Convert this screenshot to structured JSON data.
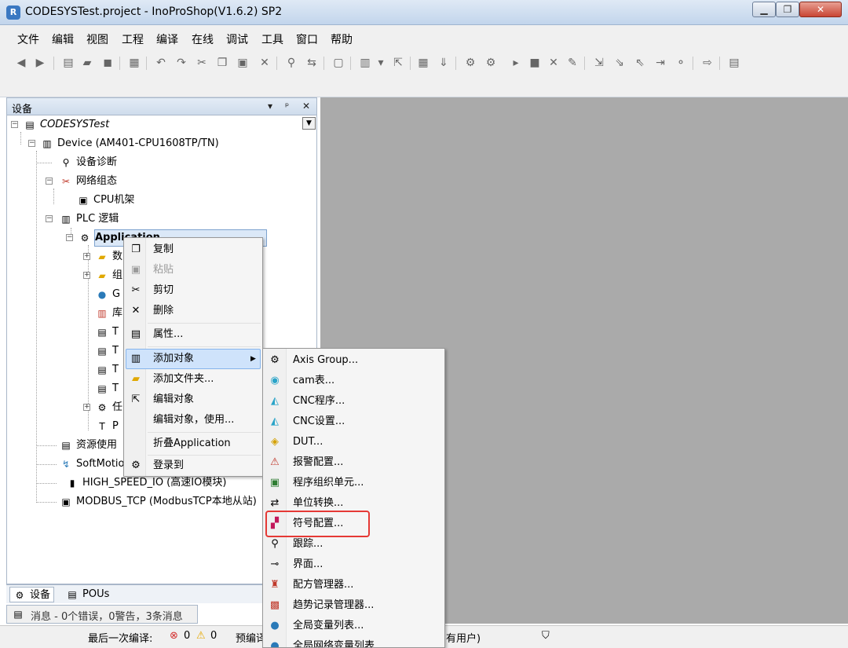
{
  "window": {
    "title": "CODESYSTest.project - InoProShop(V1.6.2) SP2",
    "icon_letter": "R",
    "min_glyph": "▁",
    "max_glyph": "❐",
    "close_glyph": "✕"
  },
  "menu": [
    "文件",
    "编辑",
    "视图",
    "工程",
    "编译",
    "在线",
    "调试",
    "工具",
    "窗口",
    "帮助"
  ],
  "device_panel": {
    "title": "设备",
    "pin_glyph": "▾",
    "dock_glyph": "ᵖ",
    "close_glyph": "✕",
    "dropdown_glyph": "▼",
    "tree": [
      {
        "label": "CODESYSTest"
      },
      {
        "label": "Device (AM401-CPU1608TP/TN)"
      },
      {
        "label": "设备诊断"
      },
      {
        "label": "网络组态"
      },
      {
        "label": "CPU机架"
      },
      {
        "label": "PLC 逻辑"
      },
      {
        "label": "Application"
      },
      {
        "label": "数"
      },
      {
        "label": "组"
      },
      {
        "label": "G"
      },
      {
        "label": "库"
      },
      {
        "label": "T"
      },
      {
        "label": "T"
      },
      {
        "label": "T"
      },
      {
        "label": "T"
      },
      {
        "label": "任"
      },
      {
        "label": "P"
      },
      {
        "label": "资源使用"
      },
      {
        "label": "SoftMotio"
      },
      {
        "label": "HIGH_SPEED_IO (高速IO模块)"
      },
      {
        "label": "MODBUS_TCP (ModbusTCP本地从站)"
      }
    ]
  },
  "bottom_tabs": [
    {
      "label": "设备"
    },
    {
      "label": "POUs"
    }
  ],
  "messages": {
    "text": "消息 - 0个错误，0警告，3条消息"
  },
  "status": {
    "last_compile": "最后一次编译:",
    "errors": "0",
    "warnings": "0",
    "precompile": "预编译",
    "user": "有用户)"
  },
  "context_menu": [
    {
      "label": "复制",
      "enabled": true
    },
    {
      "label": "粘贴",
      "enabled": false
    },
    {
      "label": "剪切",
      "enabled": true
    },
    {
      "label": "删除",
      "enabled": true
    },
    {
      "label": "属性...",
      "enabled": true
    },
    {
      "label": "添加对象",
      "enabled": true,
      "submenu": true
    },
    {
      "label": "添加文件夹...",
      "enabled": true
    },
    {
      "label": "编辑对象",
      "enabled": true
    },
    {
      "label": "编辑对象，使用...",
      "enabled": true
    },
    {
      "label": "折叠Application",
      "enabled": true
    },
    {
      "label": "登录到",
      "enabled": true
    }
  ],
  "submenu_arrow": "▶",
  "add_object_submenu": [
    {
      "label": "Axis Group..."
    },
    {
      "label": "cam表..."
    },
    {
      "label": "CNC程序..."
    },
    {
      "label": "CNC设置..."
    },
    {
      "label": "DUT..."
    },
    {
      "label": "报警配置..."
    },
    {
      "label": "程序组织单元..."
    },
    {
      "label": "单位转换..."
    },
    {
      "label": "符号配置..."
    },
    {
      "label": "跟踪..."
    },
    {
      "label": "界面..."
    },
    {
      "label": "配方管理器..."
    },
    {
      "label": "趋势记录管理器..."
    },
    {
      "label": "全局变量列表..."
    },
    {
      "label": "全局网络变量列表"
    }
  ],
  "colors": {
    "highlight": "#e53935",
    "editor_bg": "#aaaaaa",
    "hover": "#cfe3fb"
  }
}
